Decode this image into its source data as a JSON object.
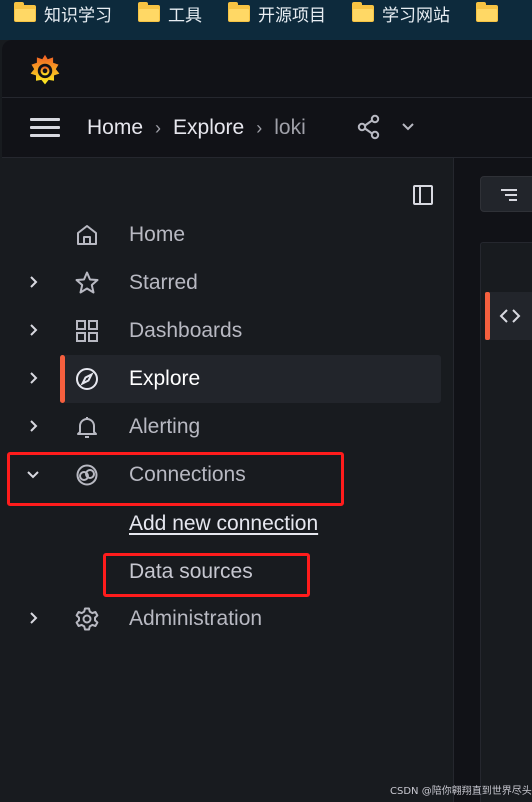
{
  "bookmarks": [
    {
      "label": "知识学习",
      "icon": "folder-icon"
    },
    {
      "label": "工具",
      "icon": "folder-icon"
    },
    {
      "label": "开源项目",
      "icon": "folder-icon"
    },
    {
      "label": "学习网站",
      "icon": "folder-icon"
    },
    {
      "label": "",
      "icon": "folder-icon"
    }
  ],
  "breadcrumb": {
    "home": "Home",
    "explore": "Explore",
    "current": "loki",
    "separator": "›"
  },
  "nav": {
    "items": [
      {
        "label": "Home",
        "icon": "home-icon",
        "expandable": false
      },
      {
        "label": "Starred",
        "icon": "star-icon",
        "expandable": true
      },
      {
        "label": "Dashboards",
        "icon": "dashboards-icon",
        "expandable": true
      },
      {
        "label": "Explore",
        "icon": "compass-icon",
        "expandable": true,
        "active": true
      },
      {
        "label": "Alerting",
        "icon": "bell-icon",
        "expandable": true
      },
      {
        "label": "Connections",
        "icon": "connections-icon",
        "expandable": true,
        "expanded": true
      },
      {
        "label": "Administration",
        "icon": "gear-icon",
        "expandable": true
      }
    ],
    "connections_children": [
      {
        "label": "Add new connection"
      },
      {
        "label": "Data sources"
      }
    ]
  },
  "colors": {
    "accent": "#f55f3e",
    "annotation": "#ff1c1c",
    "sidebar_bg": "#181b1f",
    "app_bg": "#111217"
  },
  "watermark": "CSDN @陪你翱翔直到世界尽头"
}
